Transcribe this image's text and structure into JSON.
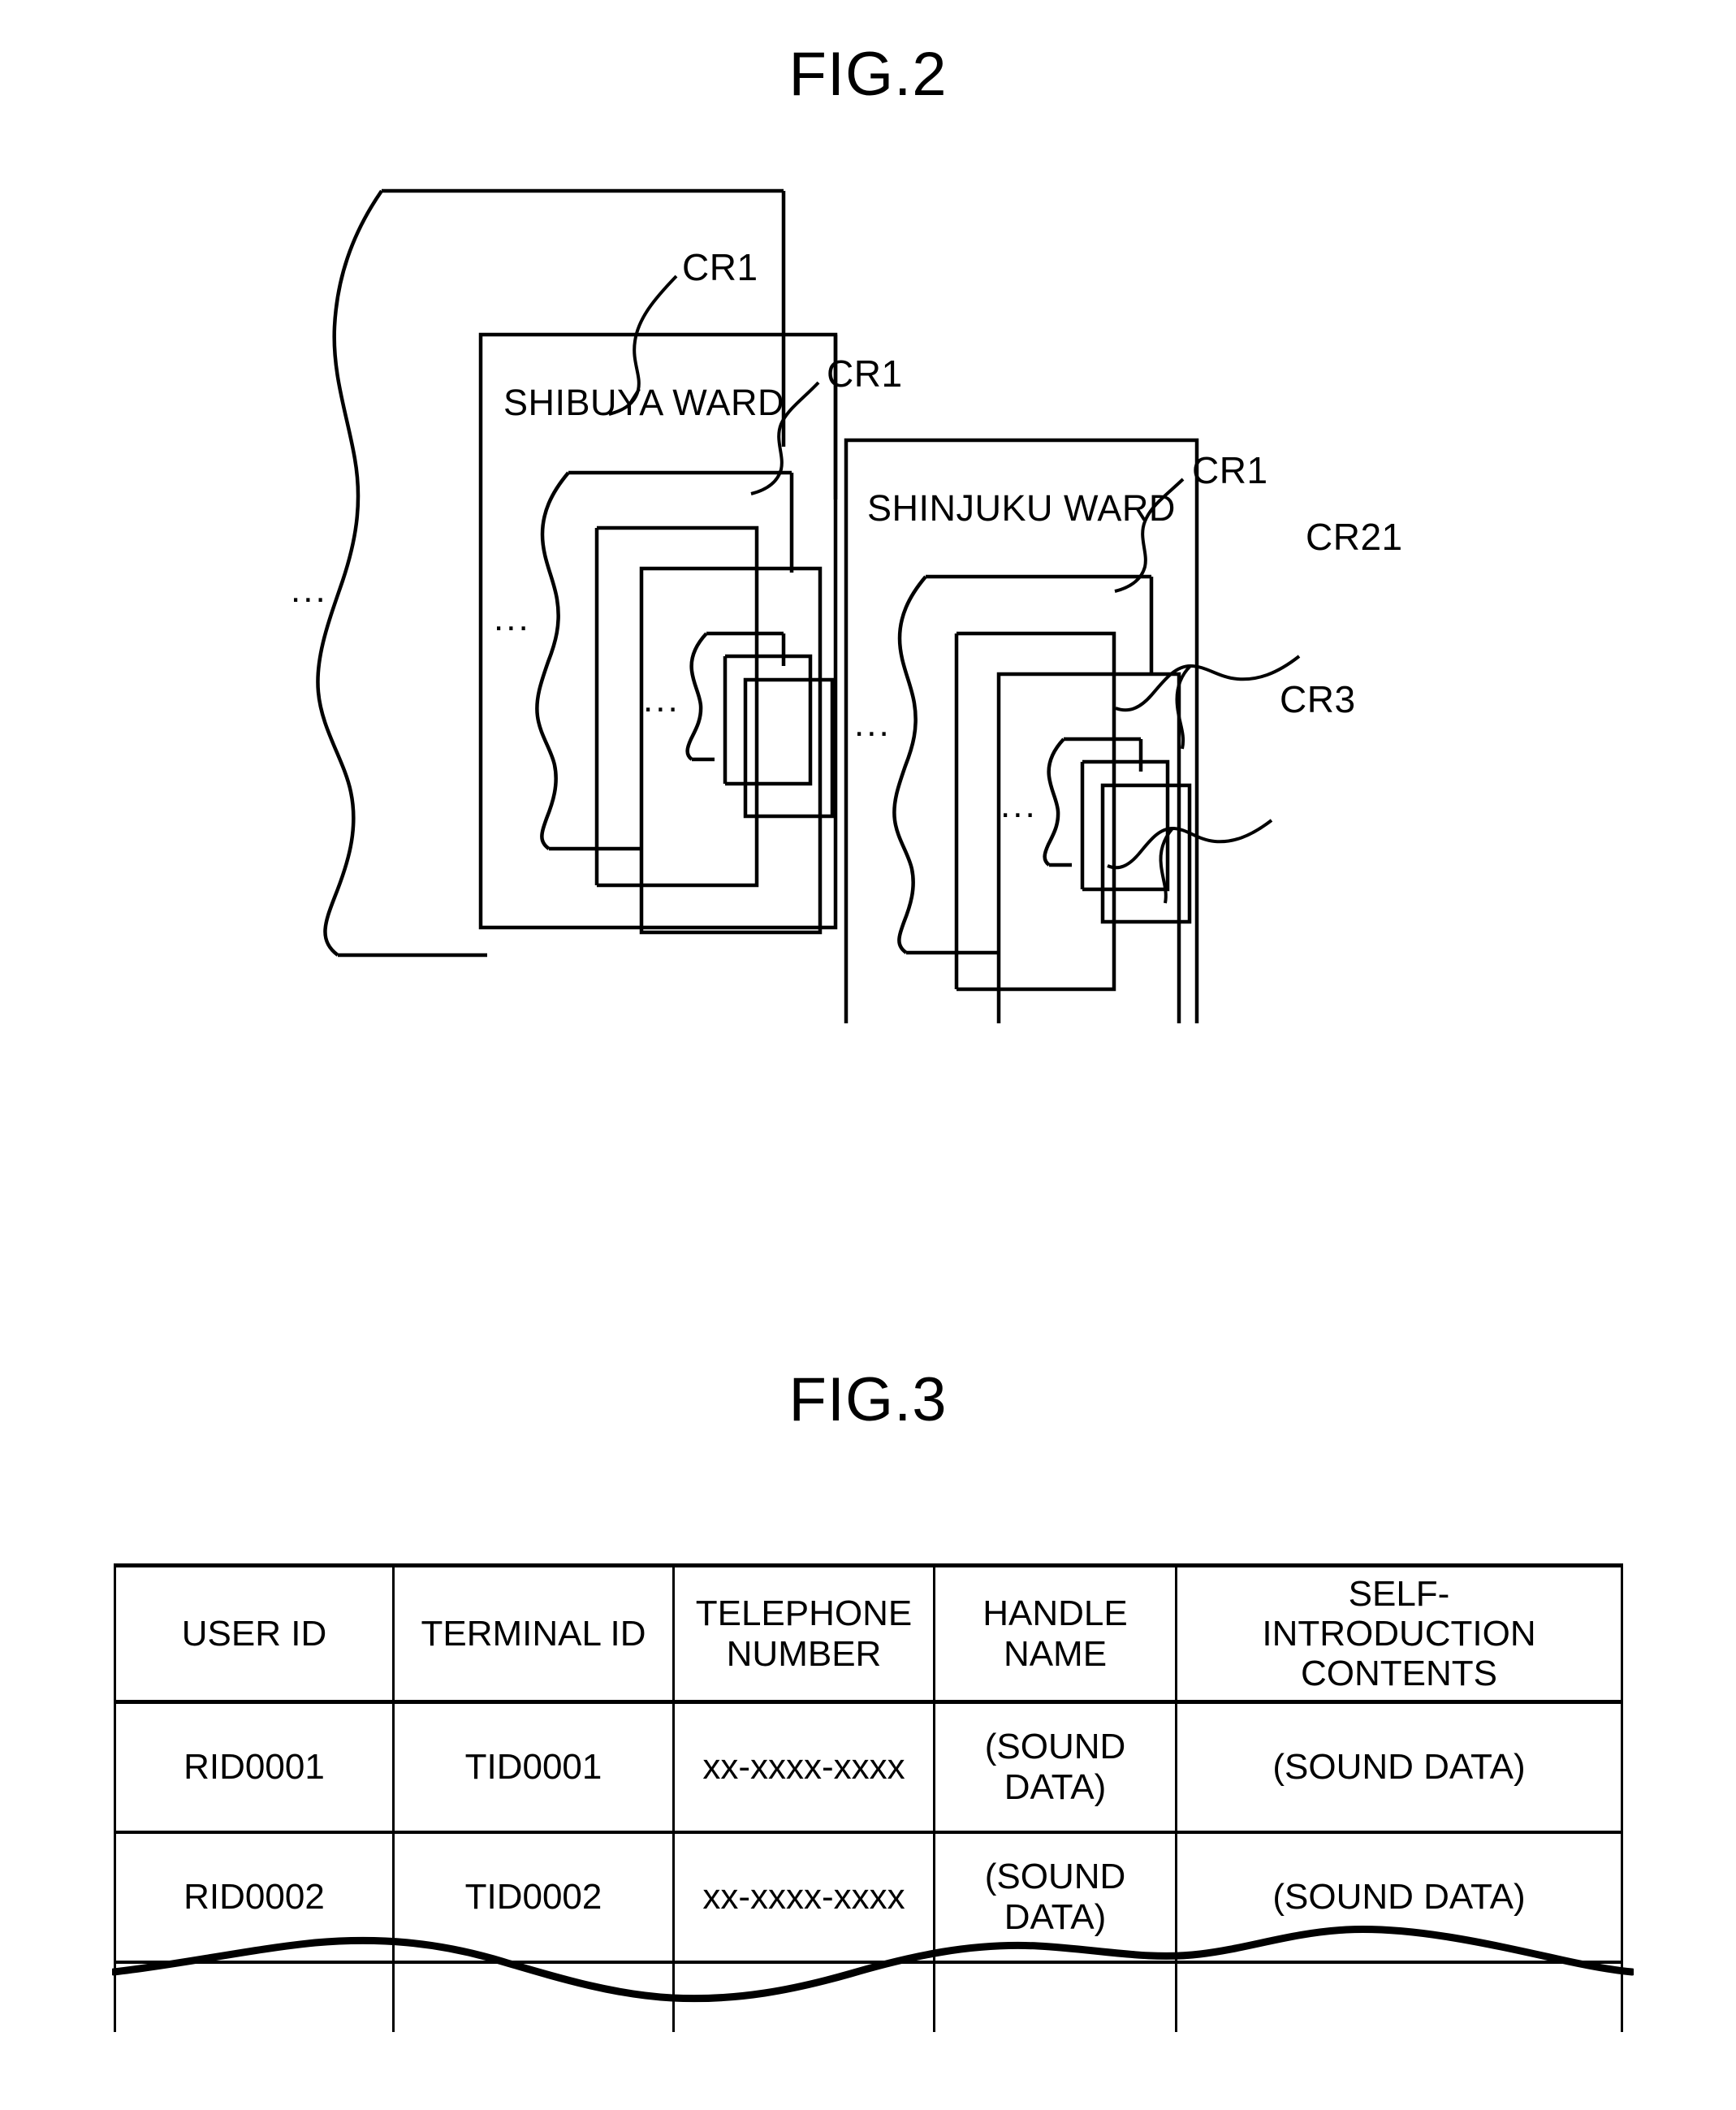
{
  "figures": [
    {
      "id": "fig2",
      "title": "FIG.2",
      "type": "stacked-record-cards",
      "cards": [
        {
          "name": "back-stack",
          "label": "",
          "ref": "CR1",
          "ellipsis": "..."
        },
        {
          "name": "shibuya-card",
          "label": "SHIBUYA WARD",
          "ref": "CR1",
          "ellipsis": "..."
        },
        {
          "name": "shinjuku-card",
          "label": "SHINJUKU WARD",
          "ref": "CR1",
          "ellipsis": "..."
        }
      ],
      "reference_labels": [
        {
          "text": "CR1",
          "target": "back-stack"
        },
        {
          "text": "CR1",
          "target": "shibuya-card"
        },
        {
          "text": "CR1",
          "target": "shinjuku-card"
        },
        {
          "text": "CR21",
          "target": "shinjuku-inner-stack"
        },
        {
          "text": "CR3",
          "target": "shinjuku-innermost-stack"
        }
      ],
      "ellipsis_marks": [
        "...",
        "...",
        "...",
        "...",
        "...",
        "..."
      ]
    },
    {
      "id": "fig3",
      "title": "FIG.3",
      "type": "data-table",
      "table": {
        "headers": [
          "USER ID",
          "TERMINAL ID",
          "TELEPHONE\nNUMBER",
          "HANDLE NAME",
          "SELF-\nINTRODUCTION\nCONTENTS"
        ],
        "header_lines": [
          [
            "USER ID"
          ],
          [
            "TERMINAL ID"
          ],
          [
            "TELEPHONE",
            "NUMBER"
          ],
          [
            "HANDLE NAME"
          ],
          [
            "SELF-",
            "INTRODUCTION",
            "CONTENTS"
          ]
        ],
        "rows": [
          [
            "RID0001",
            "TID0001",
            "xx-xxxx-xxxx",
            "(SOUND DATA)",
            "(SOUND DATA)"
          ],
          [
            "RID0002",
            "TID0002",
            "xx-xxxx-xxxx",
            "(SOUND DATA)",
            "(SOUND DATA)"
          ],
          [
            "",
            "",
            "",
            "",
            ""
          ]
        ],
        "truncated_bottom": true
      }
    }
  ],
  "fig2": {
    "title": "FIG.2",
    "labels": {
      "cr1_back": "CR1",
      "cr1_shibuya": "CR1",
      "cr1_shinjuku": "CR1",
      "cr21": "CR21",
      "cr3": "CR3"
    },
    "card_titles": {
      "shibuya": "SHIBUYA WARD",
      "shinjuku": "SHINJUKU WARD"
    },
    "ellipsis": "..."
  },
  "fig3": {
    "title": "FIG.3",
    "headers": {
      "c1": "USER ID",
      "c2": "TERMINAL ID",
      "c3_l1": "TELEPHONE",
      "c3_l2": "NUMBER",
      "c4": "HANDLE NAME",
      "c5_l1": "SELF-",
      "c5_l2": "INTRODUCTION",
      "c5_l3": "CONTENTS"
    },
    "rows": [
      {
        "user_id": "RID0001",
        "terminal_id": "TID0001",
        "telephone_number": "xx-xxxx-xxxx",
        "handle_name": "(SOUND DATA)",
        "self_introduction": "(SOUND DATA)"
      },
      {
        "user_id": "RID0002",
        "terminal_id": "TID0002",
        "telephone_number": "xx-xxxx-xxxx",
        "handle_name": "(SOUND DATA)",
        "self_introduction": "(SOUND DATA)"
      }
    ]
  },
  "colors": {
    "ink": "#000000",
    "paper": "#ffffff"
  }
}
